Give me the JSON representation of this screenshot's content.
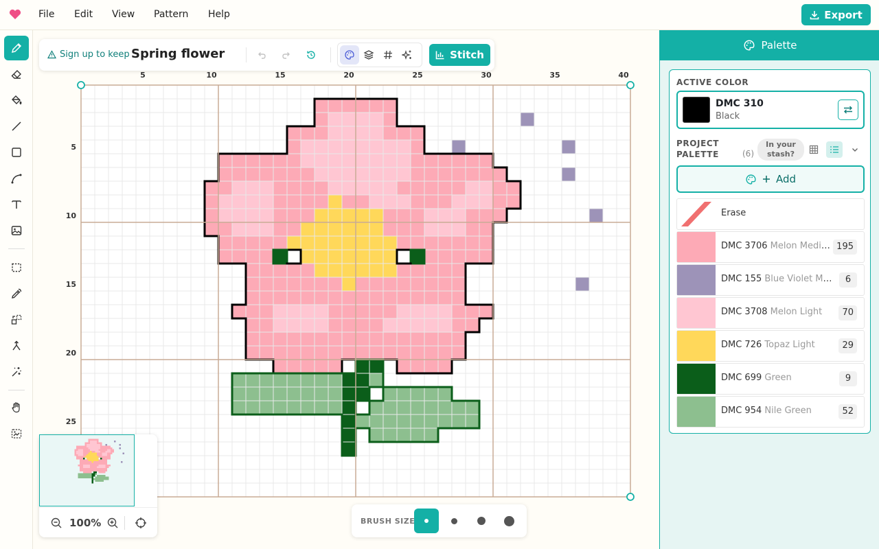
{
  "menu": {
    "items": [
      "File",
      "Edit",
      "View",
      "Pattern",
      "Help"
    ],
    "export_label": "Export"
  },
  "toolbar": {
    "tools": [
      "pencil-icon",
      "eraser-icon",
      "fill-bucket-icon",
      "line-icon",
      "rectangle-icon",
      "curve-icon",
      "text-icon",
      "image-icon",
      "selection-icon",
      "eyedropper-icon",
      "replace-color-icon",
      "merge-icon",
      "magic-wand-icon",
      "hand-icon",
      "crop-image-icon"
    ],
    "active_tool": "pencil-icon"
  },
  "pattern": {
    "signup_label": "Sign up to keep",
    "title": "Spring flower",
    "stitch_label": "Stitch"
  },
  "canvas": {
    "x_ticks": [
      "5",
      "10",
      "15",
      "20",
      "25",
      "30",
      "35",
      "40"
    ],
    "y_ticks": [
      "5",
      "10",
      "15",
      "20",
      "25"
    ],
    "rows": [
      "................................................",
      "........................................",
      ".................AAAAAA.................",
      ".................ACCCCA.........B.......",
      "...............AAACCCCAAA..............",
      "...............ACCCCCCCCA..B.......B....",
      "..........AAAAAACCCCCCCCAAAAAA..........",
      "..........AAAAAAACCCCCCCAAAAAAA....B....",
      ".........AACCCAAAACCCCCAAAAACCAA........",
      ".........ACCCCAAAADAACCCAAACCCAA........",
      ".........ACCCCAAADDDDDAAACCCAAA......B..",
      ".........AACCCAADDDDDDAAACCCAA..........",
      "..........AAAAADDDDDDDDAAAAAAA..........",
      "..........AAAAE.DDDDDDD.EAAAAA..........",
      "............AAAAADDDDDDAAAAA............",
      "............AAAAAAADAAAAAAAA........B...",
      "............AAAAAAAAAAAAAAAA............",
      "...........AAACCCCAAAAACCCCAAA..........",
      "............AACCCCAAAACCCCCAA...........",
      "............AAAAAAAAAAAAAAAA............",
      "............AAAAAAAAAAAAAAAA............",
      "..............AAAAA.EE.AAAA.............",
      "...........FFFFFFFFEEF..................",
      "...........FFFFFFFFEE.FFFFF.............",
      "...........FFFFFFFFE.FFFFFFFF...........",
      "...................EFFFFFFFFF...........",
      "...................E.FFFFF..............",
      "...................E....................",
      "........................................",
      "........................................"
    ],
    "cell_colors": {
      "A": "#fdaab6",
      "B": "#9d93b8",
      "C": "#ffc6d2",
      "D": "#ffd85a",
      "E": "#0b5e1a",
      "F": "#8dbf8f"
    }
  },
  "minimap": {
    "zoom": "100%"
  },
  "brush": {
    "label": "BRUSH SIZE"
  },
  "palette": {
    "header": "Palette",
    "active_color_label": "ACTIVE COLOR",
    "active": {
      "code": "DMC 310",
      "name": "Black",
      "color": "#000000"
    },
    "project_label_1": "PROJECT",
    "project_label_2": "PALETTE",
    "project_count": "(6)",
    "stash_1": "In your",
    "stash_2": "stash?",
    "add_label": "Add",
    "erase_label": "Erase",
    "colors": [
      {
        "code": "DMC 3706",
        "name": "Melon Medium",
        "count": "195",
        "color": "#fdaab6"
      },
      {
        "code": "DMC 155",
        "name": "Blue Violet Medi…",
        "count": "6",
        "color": "#9d93b8"
      },
      {
        "code": "DMC 3708",
        "name": "Melon Light",
        "count": "70",
        "color": "#ffc6d2"
      },
      {
        "code": "DMC 726",
        "name": "Topaz Light",
        "count": "29",
        "color": "#ffd85a"
      },
      {
        "code": "DMC 699",
        "name": "Green",
        "count": "9",
        "color": "#0b5e1a"
      },
      {
        "code": "DMC 954",
        "name": "Nile Green",
        "count": "52",
        "color": "#8dbf8f"
      }
    ]
  },
  "theme": {
    "accent": "#14b0a6",
    "grid_major": "#c9ab95",
    "grid_minor": "#e8e8e8"
  }
}
